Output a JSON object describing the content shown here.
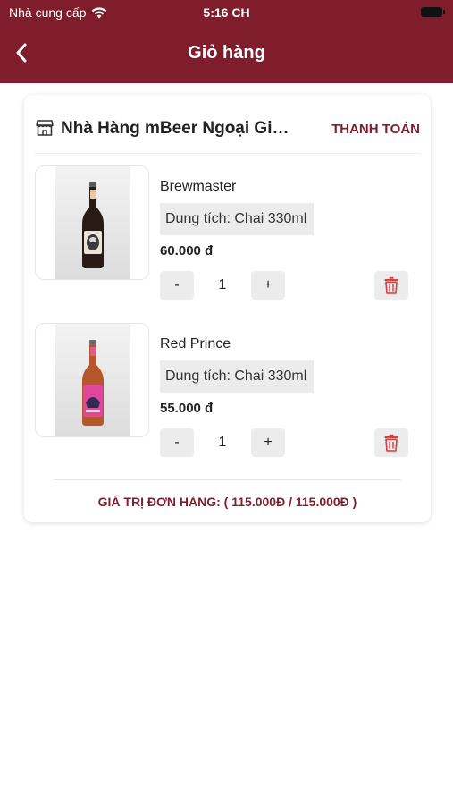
{
  "status_bar": {
    "carrier": "Nhà cung cấp",
    "time": "5:16 CH"
  },
  "header": {
    "title": "Giỏ hàng"
  },
  "store": {
    "name": "Nhà Hàng mBeer Ngoại Gi…",
    "checkout_label": "THANH TOÁN"
  },
  "items": [
    {
      "name": "Brewmaster",
      "variant": "Dung tích: Chai 330ml",
      "price": "60.000 đ",
      "quantity": "1",
      "minus": "-",
      "plus": "+"
    },
    {
      "name": "Red Prince",
      "variant": "Dung tích: Chai 330ml",
      "price": "55.000 đ",
      "quantity": "1",
      "minus": "-",
      "plus": "+"
    }
  ],
  "summary": {
    "order_value": "GIÁ TRỊ ĐƠN HÀNG: ( 115.000Đ / 115.000Đ )"
  },
  "colors": {
    "brand": "#7f1d2c",
    "delete": "#e03a3a",
    "stepper_bg": "#ececec"
  },
  "icons": {
    "back": "chevron-left-icon",
    "wifi": "wifi-icon",
    "battery": "battery-icon",
    "store": "store-icon",
    "delete": "trash-icon",
    "product": "beer-bottle-image"
  }
}
